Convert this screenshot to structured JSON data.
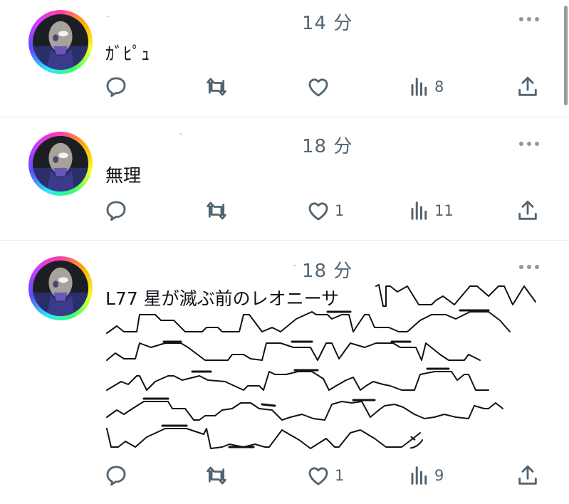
{
  "feed": {
    "tweets": [
      {
        "time": "14 分",
        "text": "ｶﾞﾋﾟｭ",
        "actions": {
          "reply": "",
          "retweet": "",
          "like": "",
          "views": "8"
        }
      },
      {
        "time": "18 分",
        "text": "無理",
        "actions": {
          "reply": "",
          "retweet": "",
          "like": "1",
          "views": "11"
        }
      },
      {
        "time": "18 分",
        "text": "L77 星が滅ぶ前のレオニーサ",
        "text_end": "ン",
        "actions": {
          "reply": "",
          "retweet": "",
          "like": "1",
          "views": "9"
        }
      }
    ]
  },
  "icons": {
    "reply": "reply-icon",
    "retweet": "retweet-icon",
    "like": "heart-icon",
    "views": "views-icon",
    "share": "share-icon",
    "more": "more-icon"
  },
  "colors": {
    "text": "#0f1419",
    "secondary": "#536471",
    "divider": "#e7e9ea"
  }
}
